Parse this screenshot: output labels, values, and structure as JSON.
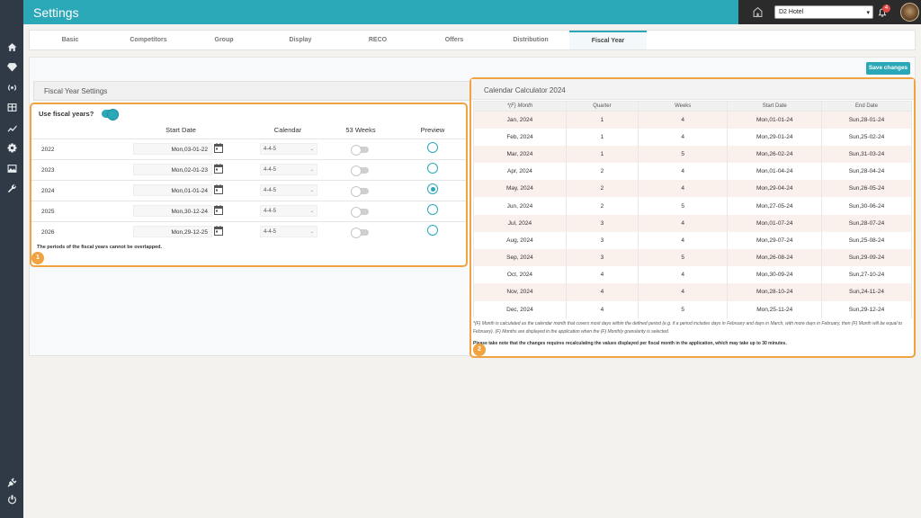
{
  "header": {
    "title": "Settings"
  },
  "hotel_select": {
    "value": "D2 Hotel"
  },
  "notifications": {
    "count": "4"
  },
  "tabs": [
    {
      "label": "Basic"
    },
    {
      "label": "Competitors"
    },
    {
      "label": "Group"
    },
    {
      "label": "Display"
    },
    {
      "label": "RECO"
    },
    {
      "label": "Offers"
    },
    {
      "label": "Distribution"
    },
    {
      "label": "Fiscal Year"
    }
  ],
  "save_button": {
    "label": "Save changes"
  },
  "fiscal": {
    "title": "Fiscal Year Settings",
    "use_label": "Use fiscal years?",
    "columns": {
      "start_date": "Start Date",
      "calendar": "Calendar",
      "weeks53": "53 Weeks",
      "preview": "Preview"
    },
    "rows": [
      {
        "year": "2022",
        "start": "Mon,03-01-22",
        "calendar": "4-4-5"
      },
      {
        "year": "2023",
        "start": "Mon,02-01-23",
        "calendar": "4-4-5"
      },
      {
        "year": "2024",
        "start": "Mon,01-01-24",
        "calendar": "4-4-5"
      },
      {
        "year": "2025",
        "start": "Mon,30-12-24",
        "calendar": "4-4-5"
      },
      {
        "year": "2026",
        "start": "Mon,29-12-25",
        "calendar": "4-4-5"
      }
    ],
    "note": "The periods of the fiscal years cannot be overlapped."
  },
  "badges": {
    "one": "1",
    "two": "2"
  },
  "calculator": {
    "title": "Calendar Calculator 2024",
    "columns": [
      "*(F) Month",
      "Quarter",
      "Weeks",
      "Start Date",
      "End Date"
    ],
    "rows": [
      [
        "Jan, 2024",
        "1",
        "4",
        "Mon,01-01-24",
        "Sun,28-01-24"
      ],
      [
        "Feb, 2024",
        "1",
        "4",
        "Mon,29-01-24",
        "Sun,25-02-24"
      ],
      [
        "Mar, 2024",
        "1",
        "5",
        "Mon,26-02-24",
        "Sun,31-03-24"
      ],
      [
        "Apr, 2024",
        "2",
        "4",
        "Mon,01-04-24",
        "Sun,28-04-24"
      ],
      [
        "May, 2024",
        "2",
        "4",
        "Mon,29-04-24",
        "Sun,26-05-24"
      ],
      [
        "Jun, 2024",
        "2",
        "5",
        "Mon,27-05-24",
        "Sun,30-06-24"
      ],
      [
        "Jul, 2024",
        "3",
        "4",
        "Mon,01-07-24",
        "Sun,28-07-24"
      ],
      [
        "Aug, 2024",
        "3",
        "4",
        "Mon,29-07-24",
        "Sun,25-08-24"
      ],
      [
        "Sep, 2024",
        "3",
        "5",
        "Mon,26-08-24",
        "Sun,29-09-24"
      ],
      [
        "Oct, 2024",
        "4",
        "4",
        "Mon,30-09-24",
        "Sun,27-10-24"
      ],
      [
        "Nov, 2024",
        "4",
        "4",
        "Mon,28-10-24",
        "Sun,24-11-24"
      ],
      [
        "Dec, 2024",
        "4",
        "5",
        "Mon,25-11-24",
        "Sun,29-12-24"
      ]
    ],
    "note": "*(F) Month is calculated as the calendar month that covers most days within the defined period (e.g. if a period includes days in February and days in March, with more days in February, then (F) Month will be equal to February). (F) Months are displayed in the application when the (F) Monthly granularity is selected.",
    "warning": "Please take note that the changes requires recalculating the values displayed per fiscal month in the application, which may take up to 30 minutes."
  }
}
